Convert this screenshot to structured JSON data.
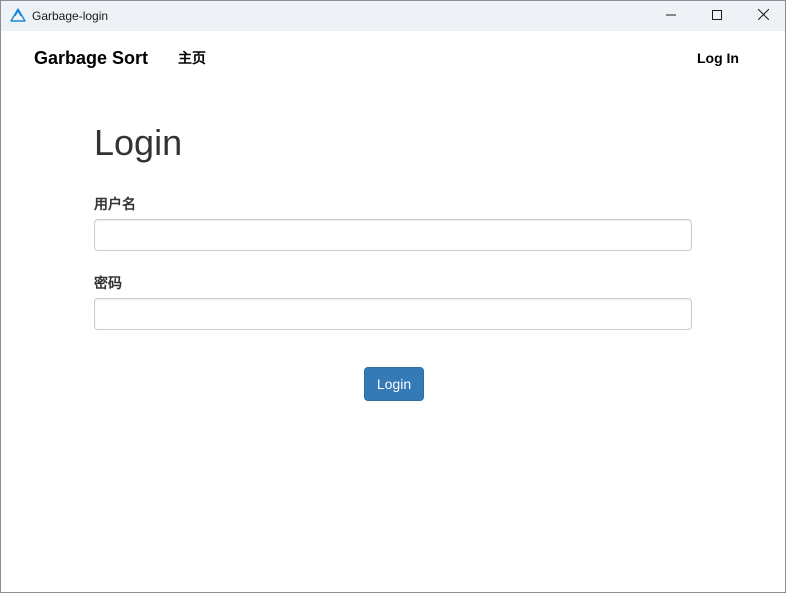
{
  "window": {
    "title": "Garbage-login",
    "app_icon": "recycle-triangle-icon",
    "controls": {
      "minimize_icon": "minimize-icon",
      "maximize_icon": "maximize-icon",
      "close_icon": "close-icon"
    }
  },
  "navbar": {
    "brand": "Garbage Sort",
    "home_link": "主页",
    "login_link": "Log In"
  },
  "form": {
    "heading": "Login",
    "username_label": "用户名",
    "username_value": "",
    "password_label": "密码",
    "password_value": "",
    "submit_label": "Login"
  },
  "colors": {
    "titlebar_bg": "#eef2f7",
    "primary_button": "#337ab7",
    "app_icon": "#1e88d6"
  }
}
